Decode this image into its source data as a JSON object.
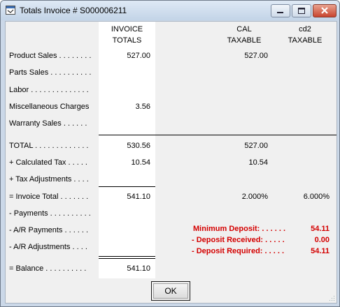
{
  "window": {
    "title": "Totals Invoice # S000006211",
    "icons": {
      "app": "invoice-app-icon",
      "minimize": "minimize-icon",
      "maximize": "maximize-icon",
      "close": "close-icon"
    }
  },
  "columns": {
    "invoice": {
      "line1": "INVOICE",
      "line2": "TOTALS"
    },
    "cal": {
      "line1": "CAL",
      "line2": "TAXABLE"
    },
    "cd2": {
      "line1": "cd2",
      "line2": "TAXABLE"
    }
  },
  "rows": {
    "product_sales": {
      "label": "Product Sales . . . . . . . .",
      "invoice": "527.00",
      "cal": "527.00",
      "cd2": ""
    },
    "parts_sales": {
      "label": "Parts Sales . . . . . . . . . .",
      "invoice": "",
      "cal": "",
      "cd2": ""
    },
    "labor": {
      "label": "Labor . . . . . . . . . . . . . .",
      "invoice": "",
      "cal": "",
      "cd2": ""
    },
    "misc_charges": {
      "label": "Miscellaneous Charges",
      "invoice": "3.56",
      "cal": "",
      "cd2": ""
    },
    "warranty_sales": {
      "label": "Warranty Sales . . . . . .",
      "invoice": "",
      "cal": "",
      "cd2": ""
    },
    "total": {
      "label": "TOTAL . . . . . . . . . . . . .",
      "invoice": "530.56",
      "cal": "527.00",
      "cd2": ""
    },
    "calculated_tax": {
      "label": "+ Calculated Tax . . . . .",
      "invoice": "10.54",
      "cal": "10.54",
      "cd2": ""
    },
    "tax_adjustments": {
      "label": "+ Tax Adjustments . . . .",
      "invoice": "",
      "cal": "",
      "cd2": ""
    },
    "invoice_total": {
      "label": "= Invoice Total . . . . . . .",
      "invoice": "541.10",
      "cal": "2.000%",
      "cd2": "6.000%"
    },
    "payments": {
      "label": "- Payments . . . . . . . . . .",
      "invoice": ""
    },
    "ar_payments": {
      "label": "- A/R Payments . . . . . .",
      "invoice": ""
    },
    "ar_adjustments": {
      "label": "- A/R Adjustments . . . .",
      "invoice": ""
    },
    "balance": {
      "label": "= Balance . . . . . . . . . .",
      "invoice": "541.10"
    }
  },
  "deposit": {
    "minimum_label": "Minimum Deposit: . . . . . .",
    "minimum_value": "54.11",
    "received_label": "- Deposit Received: . . . . .",
    "received_value": "0.00",
    "required_label": "- Deposit Required: . . . . .",
    "required_value": "54.11",
    "color": "#d40000"
  },
  "buttons": {
    "ok": "OK"
  }
}
